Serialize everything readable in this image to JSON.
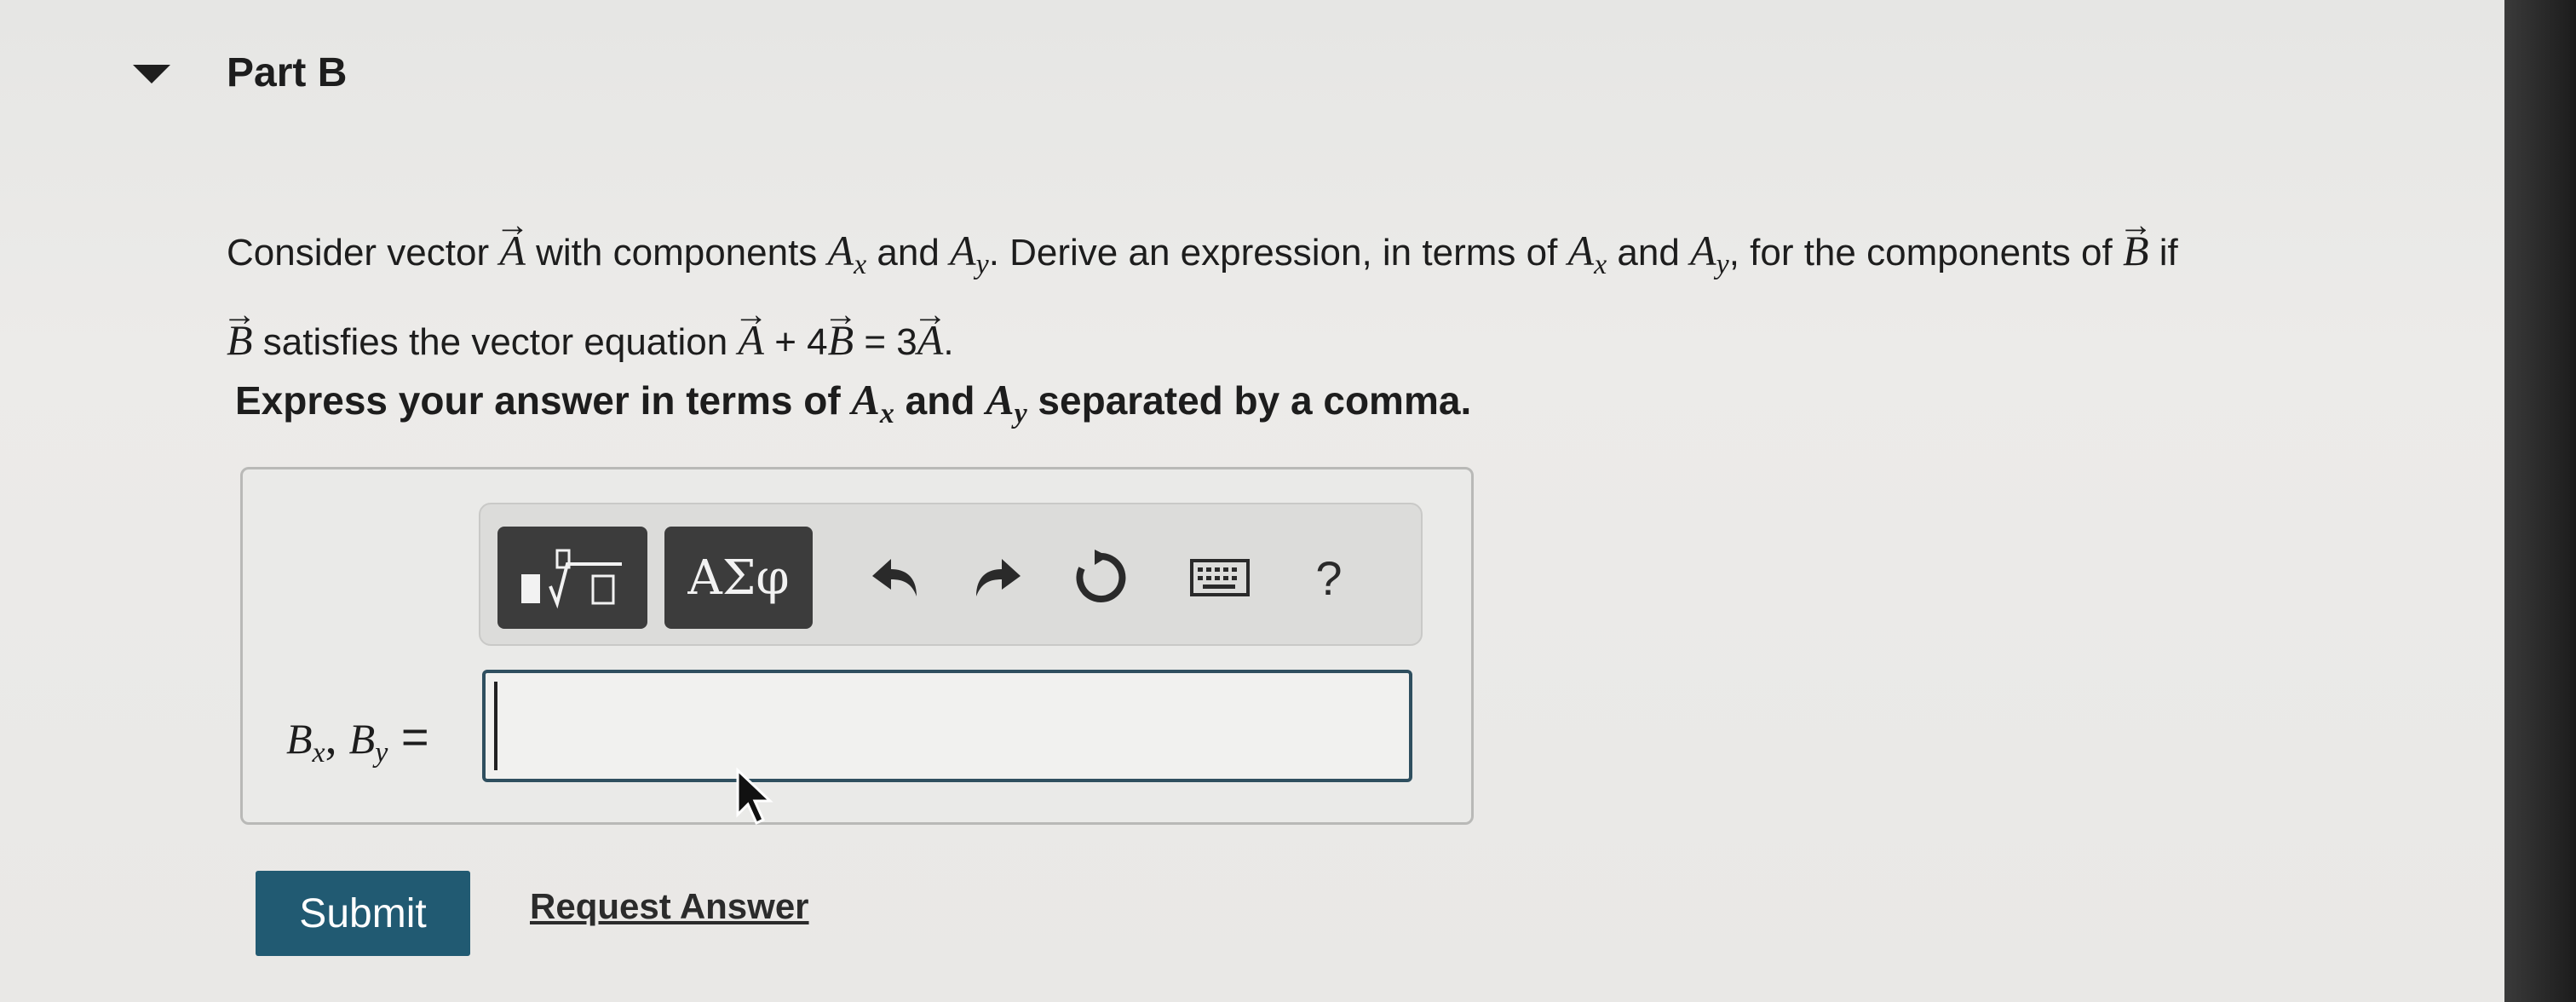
{
  "part": {
    "title": "Part B"
  },
  "question": {
    "t1": "Consider vector ",
    "vecA": "A",
    "t2": " with components ",
    "A": "A",
    "x": "x",
    "y": "y",
    "and": " and ",
    "t3": ". Derive an expression, in terms of ",
    "t4": ", for the components of ",
    "vecB": "B",
    "t5": " if",
    "t6": " satisfies the vector equation ",
    "eq1": " + 4",
    "eq2": " = 3",
    "period": "."
  },
  "instruction": {
    "t1": "Express your answer in terms of ",
    "t2": " and ",
    "t3": " separated by a comma."
  },
  "toolbar": {
    "symbols_label": "ΑΣφ",
    "help_label": "?"
  },
  "input": {
    "label_B": "B",
    "label_x": "x",
    "label_comma": ", ",
    "label_y": "y",
    "label_eq": " =",
    "value": ""
  },
  "actions": {
    "submit_label": "Submit",
    "request_label": "Request Answer"
  }
}
